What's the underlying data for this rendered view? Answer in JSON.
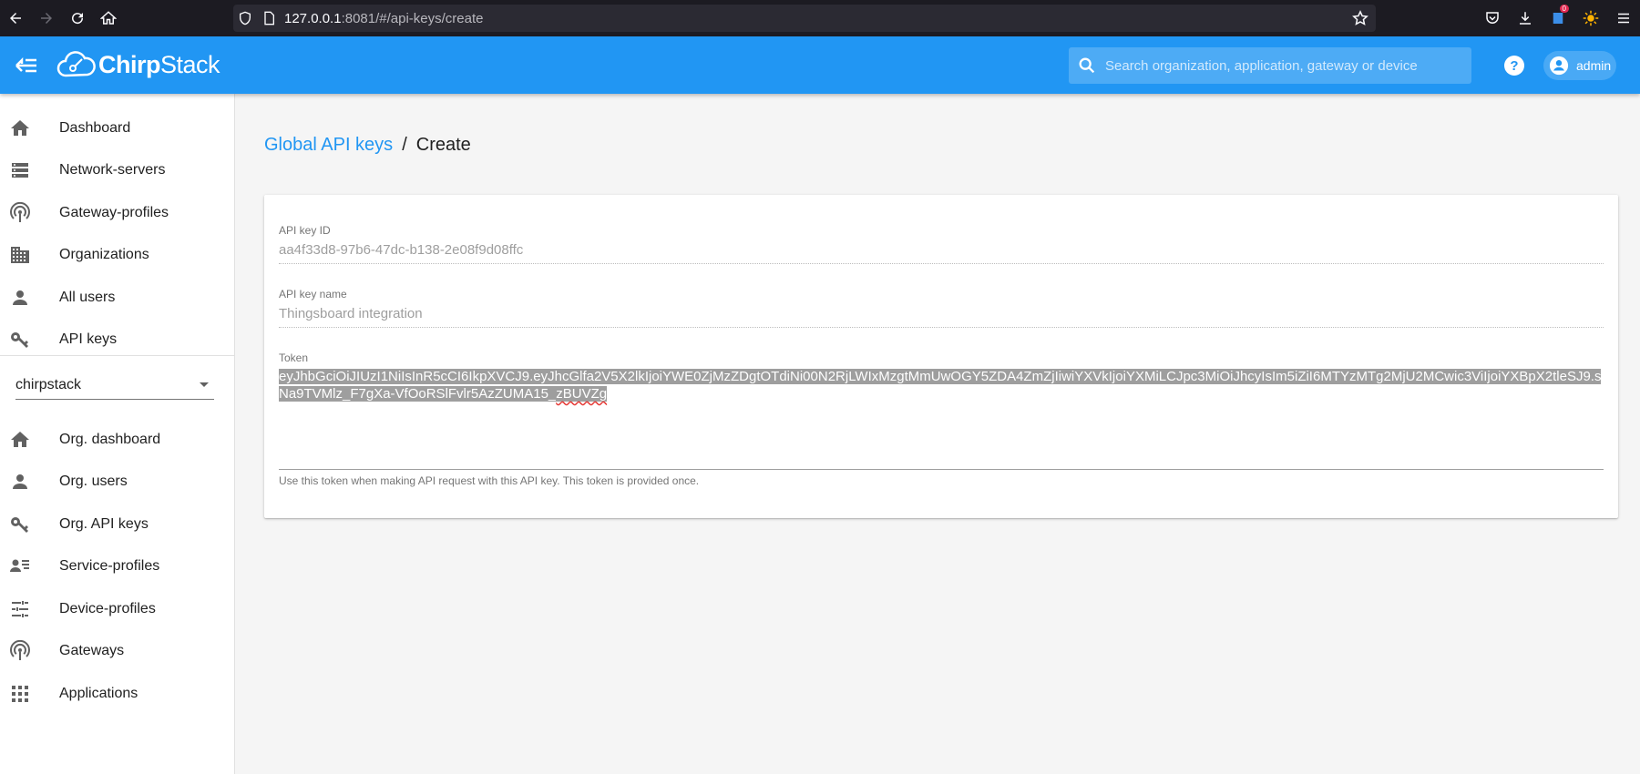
{
  "browser": {
    "url_host": "127.0.0.1",
    "url_path": ":8081/#/api-keys/create",
    "notif_count": "0"
  },
  "header": {
    "logo_bold": "Chirp",
    "logo_light": "Stack",
    "search_placeholder": "Search organization, application, gateway or device",
    "user": "admin"
  },
  "sidebar": {
    "global_items": [
      {
        "label": "Dashboard",
        "icon": "home-icon"
      },
      {
        "label": "Network-servers",
        "icon": "server-icon"
      },
      {
        "label": "Gateway-profiles",
        "icon": "radio-tower-icon"
      },
      {
        "label": "Organizations",
        "icon": "domain-icon"
      },
      {
        "label": "All users",
        "icon": "person-icon"
      },
      {
        "label": "API keys",
        "icon": "key-icon"
      }
    ],
    "org_select": "chirpstack",
    "org_items": [
      {
        "label": "Org. dashboard",
        "icon": "home-icon"
      },
      {
        "label": "Org. users",
        "icon": "person-icon"
      },
      {
        "label": "Org. API keys",
        "icon": "key-icon"
      },
      {
        "label": "Service-profiles",
        "icon": "account-details-icon"
      },
      {
        "label": "Device-profiles",
        "icon": "tune-icon"
      },
      {
        "label": "Gateways",
        "icon": "radio-tower-icon"
      },
      {
        "label": "Applications",
        "icon": "apps-icon"
      }
    ]
  },
  "breadcrumb": {
    "link": "Global API keys",
    "separator": "/",
    "current": "Create"
  },
  "form": {
    "id_label": "API key ID",
    "id_value": "aa4f33d8-97b6-47dc-b138-2e08f9d08ffc",
    "name_label": "API key name",
    "name_value": "Thingsboard integration",
    "token_label": "Token",
    "token_main": "eyJhbGciOiJIUzI1NiIsInR5cCI6IkpXVCJ9.eyJhcGlfa2V5X2lkIjoiYWE0ZjMzZDgtOTdiNi00N2RjLWIxMzgtMmUwOGY5ZDA4ZmZjIiwiYXVkIjoiYXMiLCJpc3MiOiJhcyIsIm5iZiI6MTYzMTg2MjU2MCwic3ViIjoiYXBpX2tleSJ9.sNa9TVMlz_F7gXa-VfOoRSlFvlr5AzZUMA15_",
    "token_tail": "zBUVZg",
    "helper": "Use this token when making API request with this API key. This token is provided once."
  }
}
